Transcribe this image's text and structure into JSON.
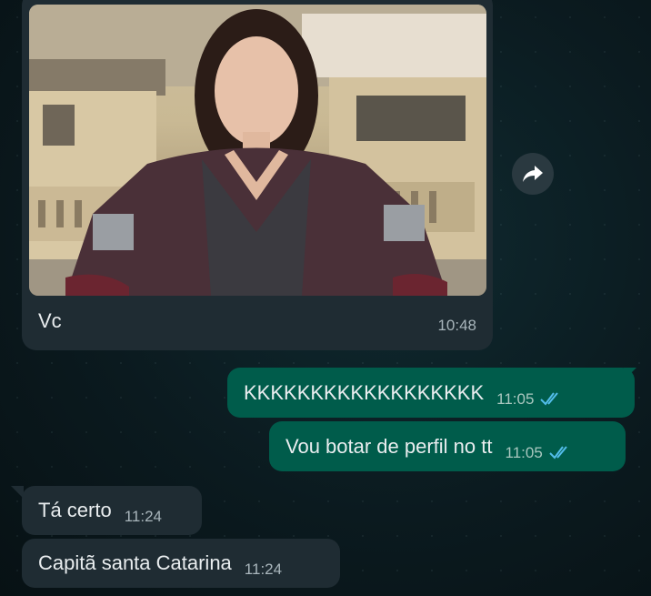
{
  "messages": {
    "image_caption": "Vc",
    "image_time": "10:48",
    "out": [
      {
        "text": "KKKKKKKKKKKKKKKKKK",
        "time": "11:05"
      },
      {
        "text": "Vou botar de perfil no tt",
        "time": "11:05"
      }
    ],
    "in": [
      {
        "text": "Tá certo",
        "time": "11:24"
      },
      {
        "text": "Capitã santa Catarina",
        "time": "11:24"
      }
    ]
  },
  "icons": {
    "forward": "forward-arrow-icon",
    "read_receipt": "double-check-icon"
  },
  "colors": {
    "incoming_bubble": "#1f2c33",
    "outgoing_bubble": "#005c4b",
    "read_tick": "#53bdeb"
  }
}
